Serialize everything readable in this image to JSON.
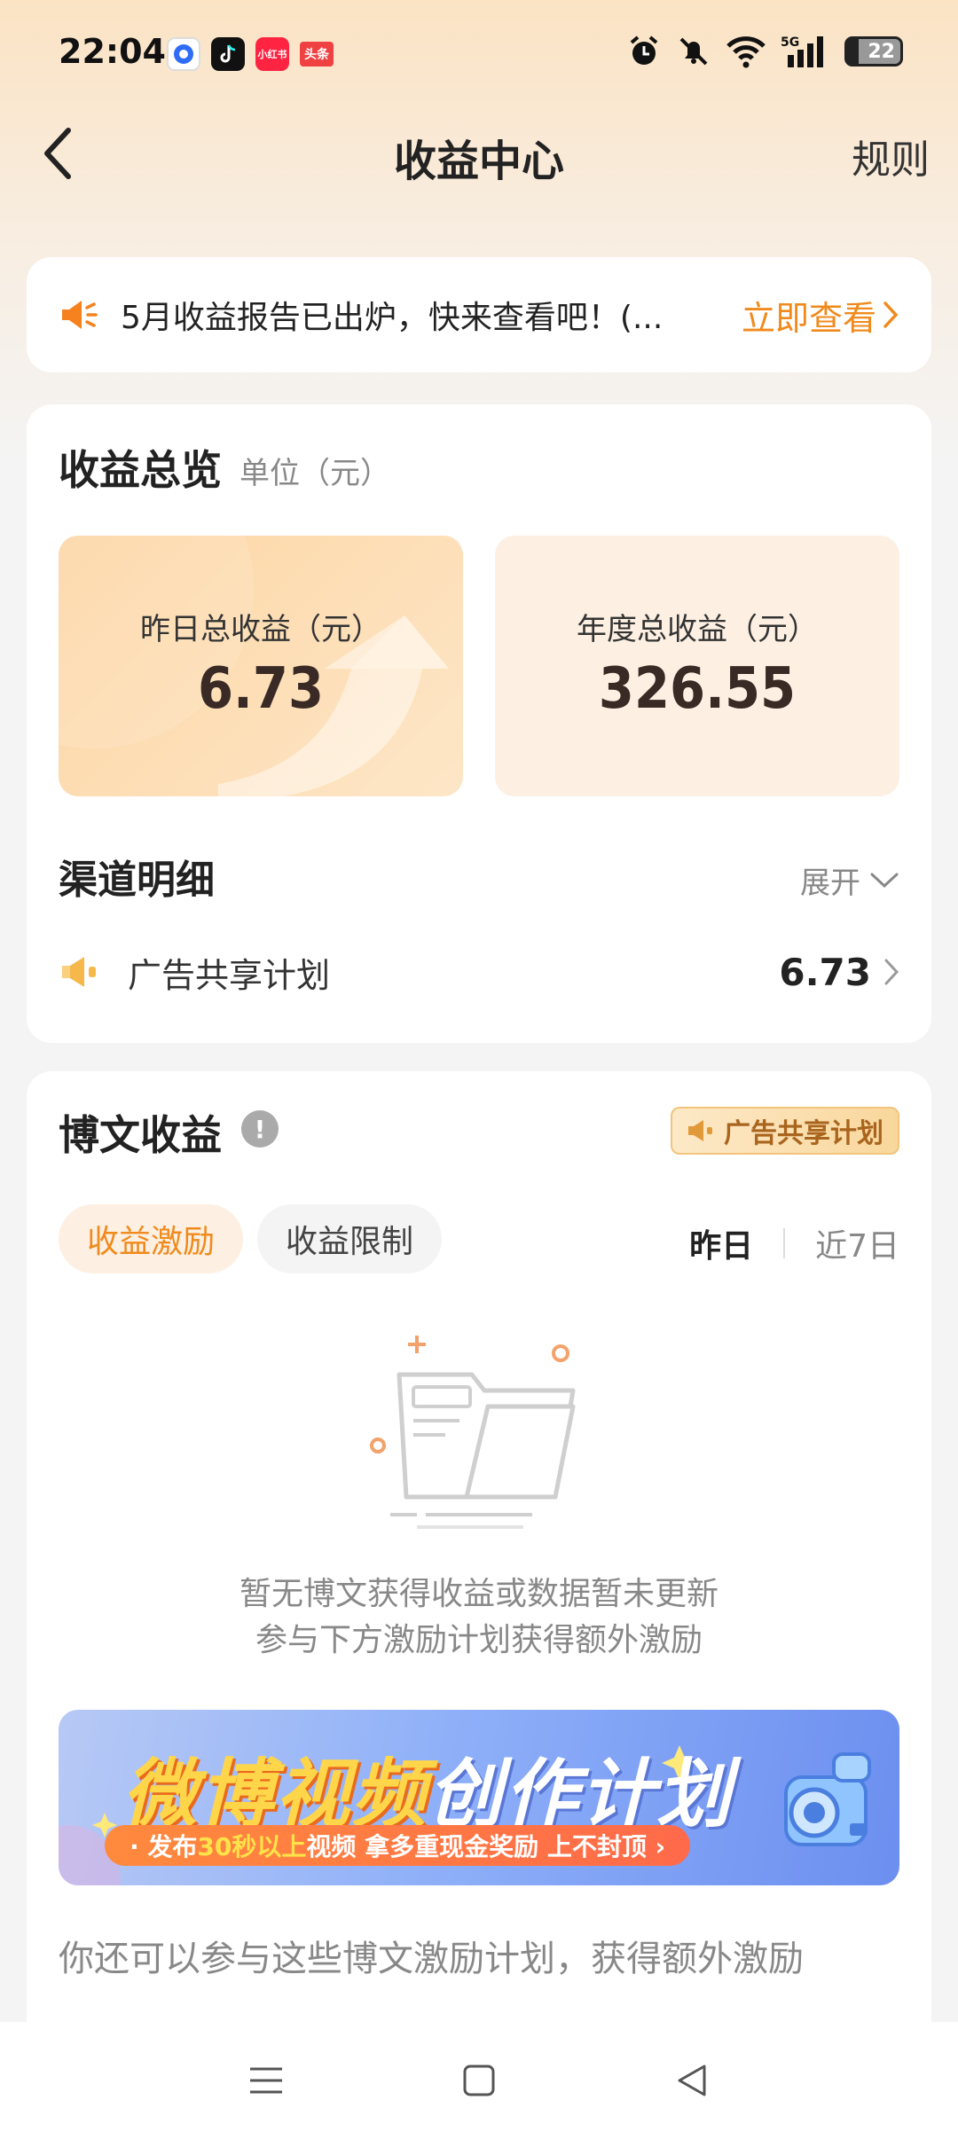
{
  "status_bar": {
    "time": "22:04",
    "apps": [
      {
        "name": "app-icon-blue",
        "label": "",
        "color": "#2f6cf5"
      },
      {
        "name": "tiktok-icon",
        "label": "",
        "color": "#111111"
      },
      {
        "name": "xiaohongshu-icon",
        "label": "小红书",
        "color": "#ff2442"
      },
      {
        "name": "toutiao-icon",
        "label": "头条",
        "color": "#f04142"
      }
    ],
    "battery": "22"
  },
  "header": {
    "title": "收益中心",
    "rules_label": "规则"
  },
  "notice": {
    "text": "5月收益报告已出炉，快来查看吧！(...",
    "link_label": "立即查看"
  },
  "overview": {
    "title": "收益总览",
    "unit": "单位（元）",
    "yesterday_label": "昨日总收益（元）",
    "yesterday_value": "6.73",
    "annual_label": "年度总收益（元）",
    "annual_value": "326.55"
  },
  "channels": {
    "title": "渠道明细",
    "expand_label": "展开",
    "items": [
      {
        "label": "广告共享计划",
        "value": "6.73"
      }
    ]
  },
  "posts": {
    "title": "博文收益",
    "ad_tag": "广告共享计划",
    "tabs": [
      "收益激励",
      "收益限制"
    ],
    "ranges": [
      "昨日",
      "近7日"
    ],
    "empty_line1": "暂无博文获得收益或数据暂未更新",
    "empty_line2": "参与下方激励计划获得额外激励",
    "banner": {
      "title_a": "微博视频",
      "title_b": "创作计划",
      "sub_a": "· 发布",
      "sub_hl": "30秒以上",
      "sub_b": "视频  拿多重现金奖励 上不封顶 ›"
    },
    "more_text": "你还可以参与这些博文激励计划，获得额外激励"
  },
  "colors": {
    "accent": "#f08a1c",
    "card": "#ffffff",
    "background": "#f4f4f4"
  }
}
